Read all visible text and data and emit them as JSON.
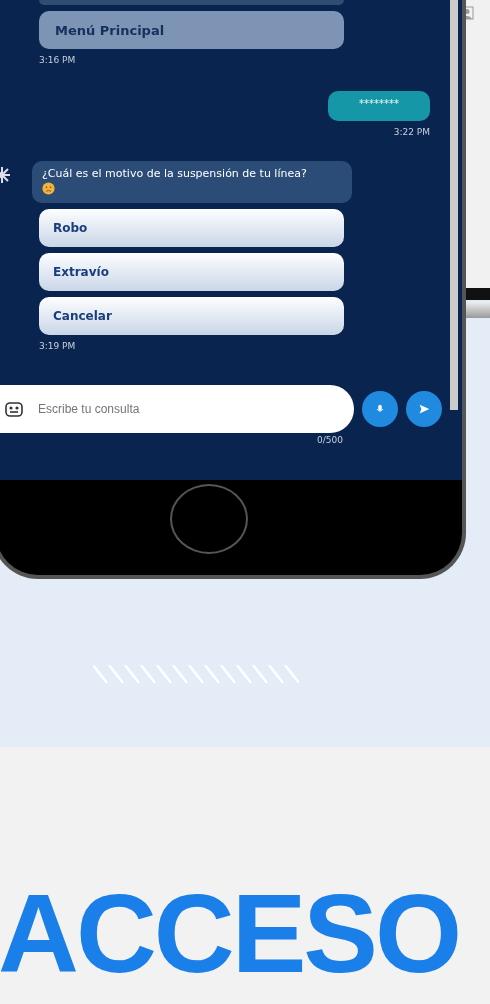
{
  "chat": {
    "menu_button": {
      "label": "Menú Principal",
      "disabled": true
    },
    "menu_time": "3:16 PM",
    "user_message": {
      "text": "********",
      "time": "3:22 PM"
    },
    "bot_message": {
      "text": "¿Cuál es el motivo de la suspensión de tu línea?",
      "options": [
        "Robo",
        "Extravío",
        "Cancelar"
      ],
      "time": "3:19 PM"
    },
    "input": {
      "placeholder": "Escribe tu consulta",
      "counter": "0/500"
    }
  },
  "heading": "ACCESO"
}
